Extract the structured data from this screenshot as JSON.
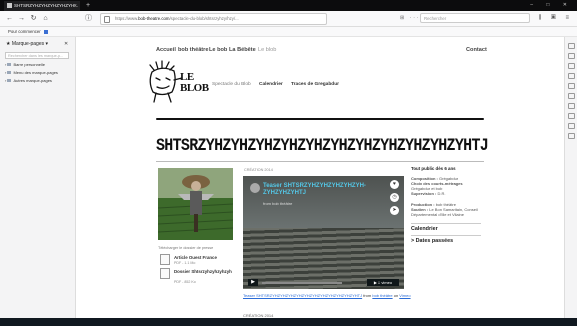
{
  "browser": {
    "tab_title": "SHTSRZYHZYHZYHZYHZYH...",
    "new_tab": "+",
    "window_controls": "– □ ✕",
    "url_prefix": "https://www.",
    "url_domain": "bob-theatre.com",
    "url_rest": "/spectacle-du-blob/shtsrzyhzy/hzy/...",
    "page_tools": "⊞ ··· ♡ ☆",
    "search_placeholder": "Rechercher",
    "bookmark": "Pour commencer",
    "sidebar_title": "Marque-pages ▾",
    "sidebar_close": "✕",
    "sidebar_search_placeholder": "Rechercher dans les marque-p...",
    "sidebar_items": [
      "Barre personnelle",
      "Menu des marque-pages",
      "Autres marque-pages"
    ]
  },
  "site": {
    "nav": [
      "Accueil",
      "bob théâtre",
      "Le bob",
      "La Bébête",
      "Le blob"
    ],
    "nav_right": "Contact",
    "logo_text": "LE BLOB",
    "subnav": [
      "Spectacle du Blob",
      "Calendrier",
      "Traces de Gregabdur"
    ],
    "title": "SHTSRZYHZYHZYHZYHZYHZYHZYHZYHZYHZYHZYHTJ",
    "photo_caption": "Télécharger le dossier de presse",
    "docs": [
      {
        "title": "Article Ouest France",
        "size": "PDF - 1.1 Mo"
      },
      {
        "title": "Dossier Shtsrzyhzyhzyhzyh",
        "size": "PDF - 852 Ko"
      }
    ],
    "video_label": "CRÉATION 2014",
    "video_title": "Teaser SHTSRZYHZYHZYHZYHZYH-ZYHZYHZYHTJ",
    "video_by": "from bob théâtre",
    "vimeo": "▶ ⁞⁞ vimeo",
    "caption_prefix": "Teaser SHTSRZYHZYHZYHZYHZYHZYHZYHZYHZYHZYHZYHTJ",
    "caption_from": " from ",
    "caption_link1": "bob théâtre",
    "caption_on": " on ",
    "caption_link2": "Vimeo",
    "date": "CRÉATION 2014",
    "right_col": {
      "public": "Tout public dès 6 ans",
      "composition_label": "Composition :",
      "composition_value": "Grégabdur",
      "choix_label": "Choix des courts-métrages",
      "choix_value": "Grégabdur et bob",
      "supervision_label": "Supervision :",
      "supervision_value": "D.R.",
      "production_label": "Production :",
      "production_value": "bob théâtre",
      "soutien_label": "Soutien :",
      "soutien_value": "Le Bon Samaritain, Conseil Départemental d'Ille et Vilaine",
      "calendar": "Calendrier",
      "dates": "> Dates passées"
    }
  }
}
